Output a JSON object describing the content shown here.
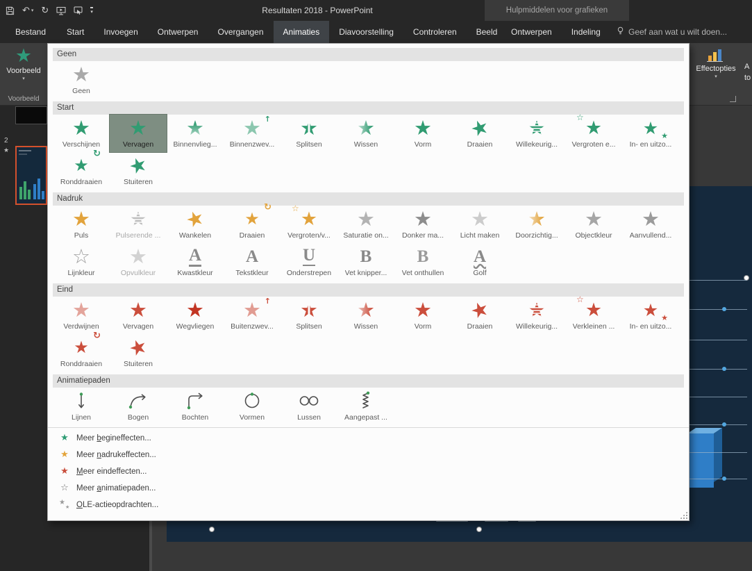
{
  "titlebar": {
    "title": "Resultaten 2018 - PowerPoint",
    "context_header": "Hulpmiddelen voor grafieken"
  },
  "tabs": {
    "file": "Bestand",
    "main": [
      "Start",
      "Invoegen",
      "Ontwerpen",
      "Overgangen",
      "Animaties",
      "Diavoorstelling",
      "Controleren",
      "Beeld"
    ],
    "active": "Animaties",
    "contextual": [
      "Ontwerpen",
      "Indeling"
    ],
    "tell_me": "Geef aan wat u wilt doen..."
  },
  "ribbon": {
    "preview_label": "Voorbeeld",
    "preview_group_label": "Voorbeeld",
    "effect_options_label": "Effectopties",
    "add_animation_fragment_line1": "A",
    "add_animation_fragment_line2": "to"
  },
  "slide_panel": {
    "slide_number": "2"
  },
  "colors": {
    "entrance": "#319c72",
    "emphasis": "#e2a33c",
    "exit": "#cb4e3c",
    "neutral": "#a9a9a9",
    "selected_tile_bg": "#7e8e82",
    "selected_slide_border": "#d4512c"
  },
  "icons": {
    "undo-icon": "↶",
    "redo-icon": "↻",
    "qat-caret-icon": "▾",
    "dropdown-caret-icon": "▾",
    "star-glyph": "★",
    "star-outline-glyph": "☆",
    "spin-arrow-glyph": "↻",
    "float-arrow-glyph": "↑",
    "animation-indicator-star": "★"
  },
  "gallery": {
    "sections": [
      {
        "header": "Geen",
        "rows": [
          [
            {
              "label": "Geen",
              "icon": "star-solid",
              "color": "#a9a9a9"
            }
          ]
        ]
      },
      {
        "header": "Start",
        "rows": [
          [
            {
              "label": "Verschijnen",
              "icon": "star-solid",
              "color": "#319c72"
            },
            {
              "label": "Vervagen",
              "icon": "star-solid",
              "color": "#319c72",
              "selected": true
            },
            {
              "label": "Binnenvlieg...",
              "icon": "star-wipe-v",
              "color": "#319c72"
            },
            {
              "label": "Binnenzwev...",
              "icon": "star-float",
              "color": "#319c72"
            },
            {
              "label": "Splitsen",
              "icon": "star-split",
              "color": "#319c72"
            },
            {
              "label": "Wissen",
              "icon": "star-wipe",
              "color": "#319c72"
            },
            {
              "label": "Vorm",
              "icon": "star-solid",
              "color": "#319c72"
            },
            {
              "label": "Draaien",
              "icon": "star-tilt",
              "color": "#319c72"
            },
            {
              "label": "Willekeurig...",
              "icon": "star-stripes",
              "color": "#319c72"
            },
            {
              "label": "Vergroten e...",
              "icon": "star-grow",
              "color": "#319c72"
            },
            {
              "label": "In- en uitzo...",
              "icon": "star-zoom",
              "color": "#319c72"
            }
          ],
          [
            {
              "label": "Ronddraaien",
              "icon": "star-spin",
              "color": "#319c72"
            },
            {
              "label": "Stuiteren",
              "icon": "star-tilt",
              "color": "#319c72"
            }
          ]
        ]
      },
      {
        "header": "Nadruk",
        "rows": [
          [
            {
              "label": "Puls",
              "icon": "star-solid",
              "color": "#e2a33c"
            },
            {
              "label": "Pulserende ...",
              "icon": "star-stripes",
              "color": "#bdbdbd",
              "disabled": true
            },
            {
              "label": "Wankelen",
              "icon": "star-tilt",
              "color": "#e2a33c"
            },
            {
              "label": "Draaien",
              "icon": "star-spin",
              "color": "#e2a33c"
            },
            {
              "label": "Vergroten/v...",
              "icon": "star-grow",
              "color": "#e2a33c"
            },
            {
              "label": "Saturatie on...",
              "icon": "star-solid",
              "color": "#b3b3b3"
            },
            {
              "label": "Donker ma...",
              "icon": "star-solid",
              "color": "#8d8d8d"
            },
            {
              "label": "Licht maken",
              "icon": "star-solid",
              "color": "#cccccc"
            },
            {
              "label": "Doorzichtig...",
              "icon": "star-wipe",
              "color": "#e2a33c"
            },
            {
              "label": "Objectkleur",
              "icon": "star-solid",
              "color": "#a6a6a6"
            },
            {
              "label": "Aanvullend...",
              "icon": "star-solid",
              "color": "#9b9b9b"
            }
          ],
          [
            {
              "label": "Lijnkleur",
              "icon": "star-outline",
              "color": "#9f9f9f"
            },
            {
              "label": "Opvulkleur",
              "icon": "star-faded",
              "color": "#a9a9a9",
              "disabled": true
            },
            {
              "label": "Kwastkleur",
              "icon": "letter-A-bar",
              "color": "#8a8a8a"
            },
            {
              "label": "Tekstkleur",
              "icon": "letter-A",
              "color": "#8a8a8a"
            },
            {
              "label": "Onderstrepen",
              "icon": "letter-U",
              "color": "#8a8a8a"
            },
            {
              "label": "Vet knipper...",
              "icon": "letter-B",
              "color": "#8a8a8a"
            },
            {
              "label": "Vet onthullen",
              "icon": "letter-B",
              "color": "#9b9b9b"
            },
            {
              "label": "Golf",
              "icon": "letter-A-wave",
              "color": "#8a8a8a"
            }
          ]
        ]
      },
      {
        "header": "Eind",
        "rows": [
          [
            {
              "label": "Verdwijnen",
              "icon": "star-faded",
              "color": "#cb4e3c"
            },
            {
              "label": "Vervagen",
              "icon": "star-solid",
              "color": "#cb4e3c"
            },
            {
              "label": "Wegvliegen",
              "icon": "star-solid",
              "color": "#c23523"
            },
            {
              "label": "Buitenzwev...",
              "icon": "star-float",
              "color": "#cb4e3c"
            },
            {
              "label": "Splitsen",
              "icon": "star-split",
              "color": "#cb4e3c"
            },
            {
              "label": "Wissen",
              "icon": "star-wipe",
              "color": "#cb4e3c"
            },
            {
              "label": "Vorm",
              "icon": "star-solid",
              "color": "#cb4e3c"
            },
            {
              "label": "Draaien",
              "icon": "star-tilt",
              "color": "#cb4e3c"
            },
            {
              "label": "Willekeurig...",
              "icon": "star-stripes",
              "color": "#cb4e3c"
            },
            {
              "label": "Verkleinen ...",
              "icon": "star-grow",
              "color": "#cb4e3c"
            },
            {
              "label": "In- en uitzo...",
              "icon": "star-zoom",
              "color": "#cb4e3c"
            }
          ],
          [
            {
              "label": "Ronddraaien",
              "icon": "star-spin",
              "color": "#cb4e3c"
            },
            {
              "label": "Stuiteren",
              "icon": "star-tilt",
              "color": "#cb4e3c"
            }
          ]
        ]
      },
      {
        "header": "Animatiepaden",
        "rows": [
          [
            {
              "label": "Lijnen",
              "icon": "path-line",
              "color": "#4f4f4f"
            },
            {
              "label": "Bogen",
              "icon": "path-arc",
              "color": "#4f4f4f"
            },
            {
              "label": "Bochten",
              "icon": "path-turn",
              "color": "#4f4f4f"
            },
            {
              "label": "Vormen",
              "icon": "path-circle",
              "color": "#4f4f4f"
            },
            {
              "label": "Lussen",
              "icon": "path-loop",
              "color": "#4f4f4f"
            },
            {
              "label": "Aangepast ...",
              "icon": "path-custom",
              "color": "#4f4f4f"
            }
          ]
        ]
      }
    ],
    "menu_items": [
      {
        "label": "Meer begineffecten...",
        "underline_index": 5,
        "icon": "star-solid",
        "color": "#2e9c74"
      },
      {
        "label": "Meer nadrukeffecten...",
        "underline_index": 5,
        "icon": "star-solid",
        "color": "#e3a43b"
      },
      {
        "label": "Meer eindeffecten...",
        "underline_index": 0,
        "icon": "star-solid",
        "color": "#c94f3d"
      },
      {
        "label": "Meer animatiepaden...",
        "underline_index": 5,
        "icon": "star-outline",
        "color": "#6f6f6f"
      },
      {
        "label": "OLE-actieopdrachten...",
        "underline_index": 0,
        "icon": "star-cluster",
        "color": "#9a9a9a"
      }
    ]
  }
}
